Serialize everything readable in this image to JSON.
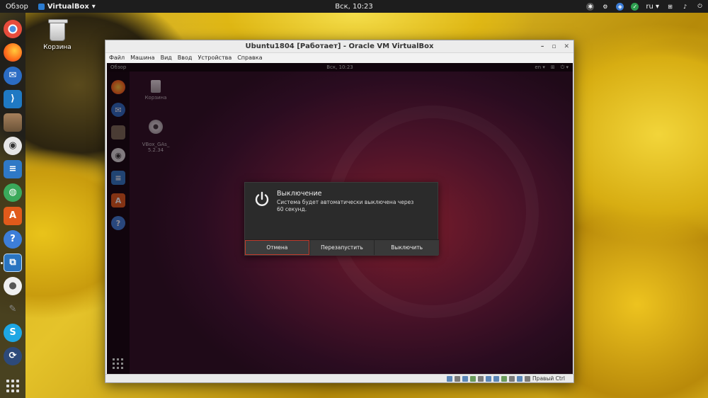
{
  "topbar": {
    "activities": "Обзор",
    "app_name": "VirtualBox",
    "clock": "Вск, 10:23",
    "language": "ru"
  },
  "desktop": {
    "trash_label": "Корзина"
  },
  "vbox": {
    "title": "Ubuntu1804 [Работает] - Oracle VM VirtualBox",
    "menu": [
      "Файл",
      "Машина",
      "Вид",
      "Ввод",
      "Устройства",
      "Справка"
    ],
    "host_key": "Правый Ctrl"
  },
  "vm": {
    "topbar_overview": "Обзор",
    "topbar_clock": "Вск, 10:23",
    "topbar_lang": "en",
    "trash_label": "Корзина",
    "cd_label": "VBox_GAs_\n5.2.34"
  },
  "dialog": {
    "title": "Выключение",
    "text": "Система будет автоматически выключена через 60 секунд.",
    "buttons": {
      "cancel": "Отмена",
      "restart": "Перезапустить",
      "power_off": "Выключить"
    }
  },
  "colors": {
    "dialog_focus": "#c0392b",
    "vm_bg": "#4c1329"
  }
}
